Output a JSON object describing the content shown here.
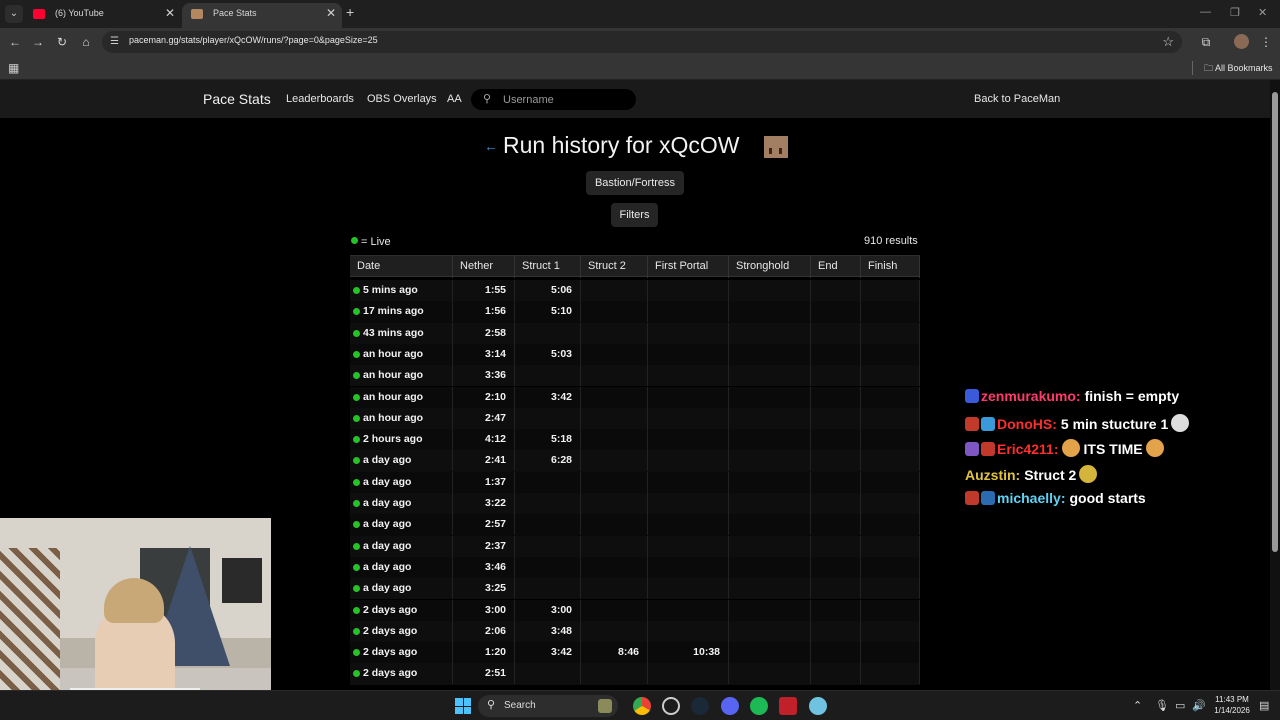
{
  "browser": {
    "tabs": [
      {
        "title": "(6) YouTube",
        "active": false
      },
      {
        "title": "Pace Stats",
        "active": true
      }
    ],
    "url": "paceman.gg/stats/player/xQcOW/runs/?page=0&pageSize=25",
    "bookmarks_label": "All Bookmarks"
  },
  "site_nav": {
    "brand": "Pace Stats",
    "links": [
      "Leaderboards",
      "OBS Overlays",
      "AA"
    ],
    "search_placeholder": "Username",
    "back_link": "Back to PaceMan"
  },
  "page": {
    "title": "Run history for xQcOW",
    "struct_filter": "Bastion/Fortress",
    "filters_label": "Filters",
    "legend": "= Live",
    "results": "910 results"
  },
  "table": {
    "columns": [
      "Date",
      "Nether",
      "Struct 1",
      "Struct 2",
      "First Portal",
      "Stronghold",
      "End",
      "Finish"
    ],
    "rows": [
      [
        "5 mins ago",
        "1:55",
        "5:06",
        "",
        "",
        "",
        "",
        ""
      ],
      [
        "17 mins ago",
        "1:56",
        "5:10",
        "",
        "",
        "",
        "",
        ""
      ],
      [
        "43 mins ago",
        "2:58",
        "",
        "",
        "",
        "",
        "",
        ""
      ],
      [
        "an hour ago",
        "3:14",
        "5:03",
        "",
        "",
        "",
        "",
        ""
      ],
      [
        "an hour ago",
        "3:36",
        "",
        "",
        "",
        "",
        "",
        ""
      ],
      [
        "an hour ago",
        "2:10",
        "3:42",
        "",
        "",
        "",
        "",
        ""
      ],
      [
        "an hour ago",
        "2:47",
        "",
        "",
        "",
        "",
        "",
        ""
      ],
      [
        "2 hours ago",
        "4:12",
        "5:18",
        "",
        "",
        "",
        "",
        ""
      ],
      [
        "a day ago",
        "2:41",
        "6:28",
        "",
        "",
        "",
        "",
        ""
      ],
      [
        "a day ago",
        "1:37",
        "",
        "",
        "",
        "",
        "",
        ""
      ],
      [
        "a day ago",
        "3:22",
        "",
        "",
        "",
        "",
        "",
        ""
      ],
      [
        "a day ago",
        "2:57",
        "",
        "",
        "",
        "",
        "",
        ""
      ],
      [
        "a day ago",
        "2:37",
        "",
        "",
        "",
        "",
        "",
        ""
      ],
      [
        "a day ago",
        "3:46",
        "",
        "",
        "",
        "",
        "",
        ""
      ],
      [
        "a day ago",
        "3:25",
        "",
        "",
        "",
        "",
        "",
        ""
      ],
      [
        "2 days ago",
        "3:00",
        "3:00",
        "",
        "",
        "",
        "",
        ""
      ],
      [
        "2 days ago",
        "2:06",
        "3:48",
        "",
        "",
        "",
        "",
        ""
      ],
      [
        "2 days ago",
        "1:20",
        "3:42",
        "8:46",
        "10:38",
        "",
        "",
        ""
      ],
      [
        "2 days ago",
        "2:51",
        "",
        "",
        "",
        "",
        "",
        ""
      ]
    ]
  },
  "chat": [
    {
      "user": "zenmurakumo:",
      "color": "#ff3b6b",
      "message": "finish = empty",
      "badges": [
        "#3a5bd9"
      ],
      "emote": ""
    },
    {
      "user": "DonoHS:",
      "color": "#ff2e2e",
      "message": "5 min stucture 1",
      "badges": [
        "#c0392b",
        "#3a9ad9"
      ],
      "emote": "#dddddd"
    },
    {
      "user": "Eric4211:",
      "color": "#ff2e2e",
      "message": "ITS TIME",
      "badges": [
        "#7e57c2",
        "#c0392b"
      ],
      "emote": "#e3a34a",
      "pre_emote": "#e3a34a"
    },
    {
      "user": "Auzstin:",
      "color": "#e0c341",
      "message": "Struct 2",
      "badges": [],
      "emote": "#d4b43a"
    },
    {
      "user": "michaelly:",
      "color": "#5fd3f3",
      "message": "good starts",
      "badges": [
        "#c0392b",
        "#2b6cb0"
      ],
      "emote": ""
    }
  ],
  "taskbar": {
    "search_label": "Search",
    "time": "11:43 PM",
    "date": "1/14/2026"
  }
}
